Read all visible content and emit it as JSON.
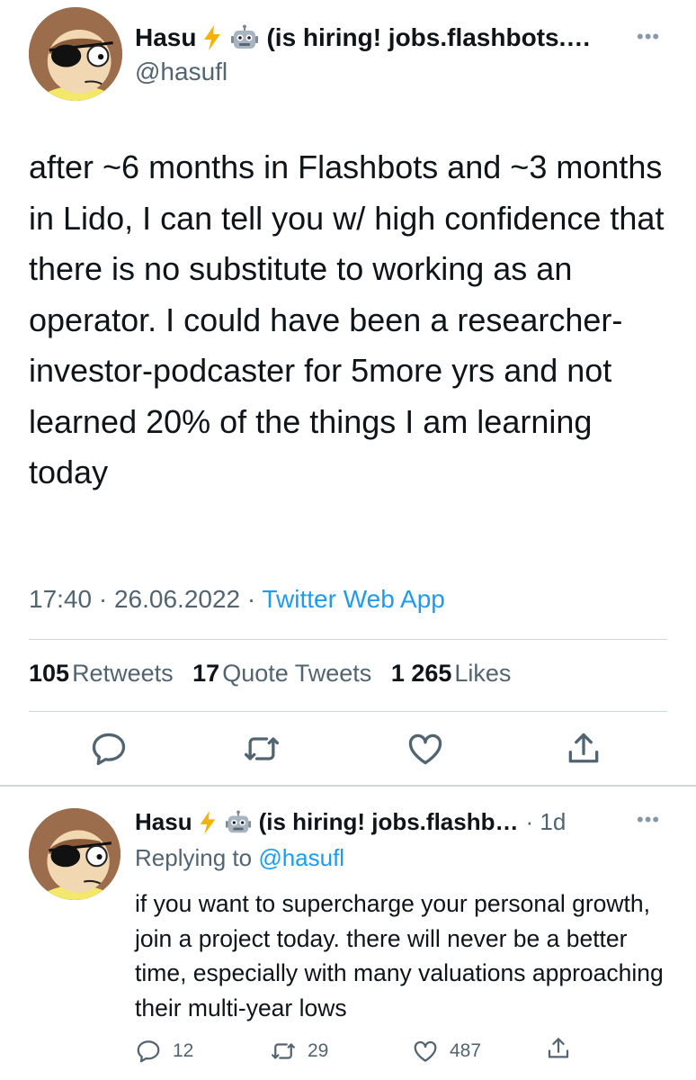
{
  "main_tweet": {
    "display_name": "Hasu",
    "bio_suffix": "(is hiring! jobs.flashbots.…",
    "handle": "@hasufl",
    "text": "after ~6 months in Flashbots and ~3 months in Lido, I can tell you w/ high confidence that there is no substitute to working as an operator. I could have been a researcher-investor-podcaster for 5more yrs and not learned 20% of the things I am learning today",
    "time": "17:40",
    "date": "26.06.2022",
    "separator": "·",
    "source": "Twitter Web App",
    "stats": {
      "retweets_count": "105",
      "retweets_label": "Retweets",
      "quotes_count": "17",
      "quotes_label": "Quote Tweets",
      "likes_count": "1 265",
      "likes_label": "Likes"
    },
    "more_icon": "ellipsis-icon"
  },
  "reply_tweet": {
    "display_name": "Hasu",
    "bio_suffix": "(is hiring! jobs.flashb…",
    "age": "· 1d",
    "replying_prefix": "Replying to",
    "replying_handle": "@hasufl",
    "text": "if you want to supercharge your personal growth, join a project today. there will never be a better time, especially with many valuations approaching their multi-year lows",
    "replies": "12",
    "retweets": "29",
    "likes": "487"
  },
  "colors": {
    "lightning": "#f5b301",
    "link": "#1d9bf0",
    "muted": "#536471"
  }
}
